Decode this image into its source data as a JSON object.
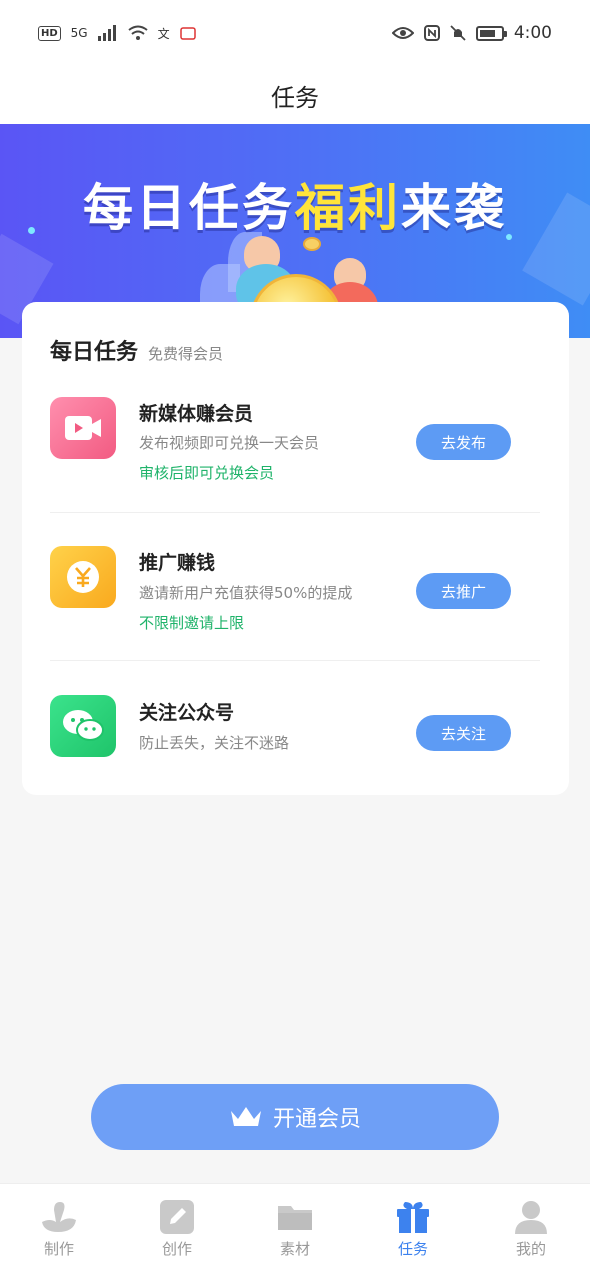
{
  "status_bar": {
    "left_badge": "HD",
    "signal_label": "5G",
    "time": "4:00"
  },
  "header": {
    "title": "任务"
  },
  "banner": {
    "title_part1": "每日任务",
    "title_highlight": "福利",
    "title_part2": "来袭"
  },
  "card": {
    "title": "每日任务",
    "subtitle": "免费得会员",
    "tasks": [
      {
        "name": "新媒体赚会员",
        "desc": "发布视频即可兑换一天会员",
        "note": "审核后即可兑换会员",
        "button": "去发布",
        "icon": "video-icon",
        "icon_color": "#f56a8c"
      },
      {
        "name": "推广赚钱",
        "desc": "邀请新用户充值获得50%的提成",
        "note": "不限制邀请上限",
        "button": "去推广",
        "icon": "yuan-icon",
        "icon_color": "#fbb82c"
      },
      {
        "name": "关注公众号",
        "desc": "防止丢失，关注不迷路",
        "button": "去关注",
        "icon": "wechat-icon",
        "icon_color": "#29d07a"
      }
    ]
  },
  "vip_button": {
    "label": "开通会员",
    "icon": "crown-icon"
  },
  "bottom_nav": {
    "items": [
      {
        "label": "制作",
        "icon": "swan-icon"
      },
      {
        "label": "创作",
        "icon": "edit-icon"
      },
      {
        "label": "素材",
        "icon": "folder-icon"
      },
      {
        "label": "任务",
        "icon": "gift-icon",
        "active": true
      },
      {
        "label": "我的",
        "icon": "user-icon"
      }
    ]
  },
  "colors": {
    "accent": "#3d82ee",
    "button": "#5d9bf4",
    "note_green": "#1fb36a",
    "banner_highlight": "#ffe43a"
  }
}
